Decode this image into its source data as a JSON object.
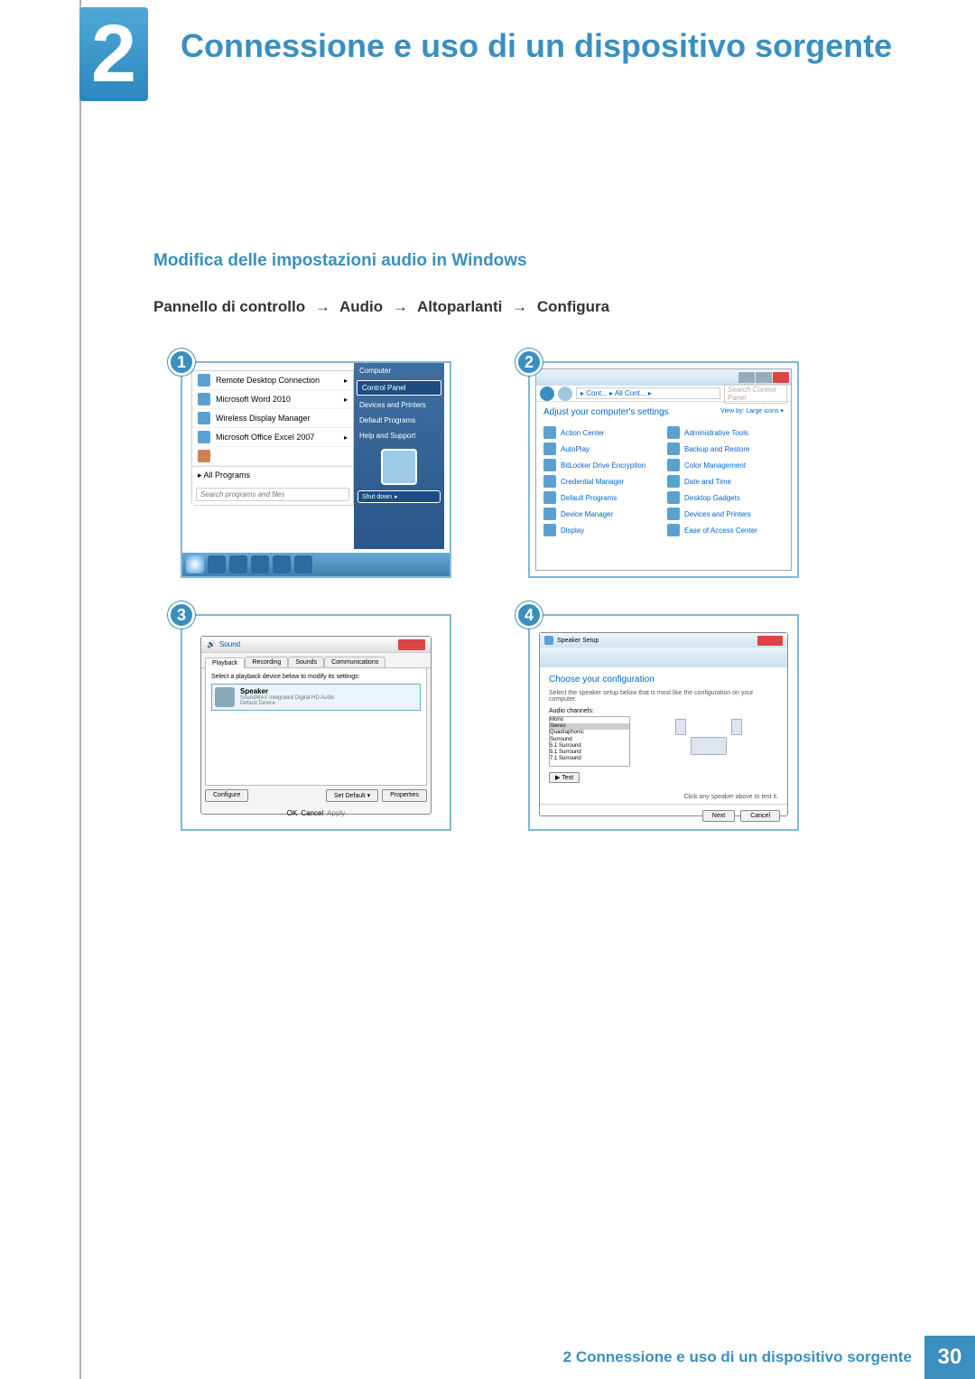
{
  "chapter": {
    "number": "2",
    "title": "Connessione e uso di un dispositivo sorgente"
  },
  "section": {
    "subtitle": "Modifica delle impostazioni audio in Windows"
  },
  "breadcrumb": {
    "p1": "Pannello di controllo",
    "p2": "Audio",
    "p3": "Altoparlanti",
    "p4": "Configura",
    "arrow": "→"
  },
  "steps": {
    "s1": {
      "num": "1",
      "items": [
        "Remote Desktop Connection",
        "Microsoft Word 2010",
        "Wireless Display Manager",
        "Microsoft Office Excel 2007"
      ],
      "all_programs": "All Programs",
      "search_placeholder": "Search programs and files",
      "right": {
        "computer": "Computer",
        "control_panel": "Control Panel",
        "devices_printers": "Devices and Printers",
        "default_programs": "Default Programs",
        "help_support": "Help and Support",
        "shutdown": "Shut down"
      }
    },
    "s2": {
      "num": "2",
      "path": "▸ Cont... ▸ All Cont... ▸",
      "search_placeholder": "Search Control Panel",
      "heading": "Adjust your computer's settings",
      "view_by": "View by: Large icons ▾",
      "links_left": [
        "Action Center",
        "AutoPlay",
        "BitLocker Drive Encryption",
        "Credential Manager",
        "Default Programs",
        "Device Manager",
        "Display"
      ],
      "links_right": [
        "Administrative Tools",
        "Backup and Restore",
        "Color Management",
        "Date and Time",
        "Desktop Gadgets",
        "Devices and Printers",
        "Ease of Access Center"
      ]
    },
    "s3": {
      "num": "3",
      "title": "Sound",
      "tabs": [
        "Playback",
        "Recording",
        "Sounds",
        "Communications"
      ],
      "instruction": "Select a playback device below to modify its settings:",
      "device": {
        "name": "Speaker",
        "sub1": "SoundMAX Integrated Digital HD Audio",
        "sub2": "Default Device"
      },
      "configure": "Configure",
      "set_default": "Set Default ▾",
      "properties": "Properties",
      "ok": "OK",
      "cancel": "Cancel",
      "apply": "Apply"
    },
    "s4": {
      "num": "4",
      "title": "Speaker Setup",
      "heading": "Choose your configuration",
      "desc": "Select the speaker setup below that is most like the configuration on your computer.",
      "channels_label": "Audio channels:",
      "channels": [
        "Mono",
        "Stereo",
        "Quadraphonic",
        "Surround",
        "5.1 Surround",
        "5.1 Surround",
        "7.1 Surround"
      ],
      "test": "▶ Test",
      "click_hint": "Click any speaker above to test it.",
      "next": "Next",
      "cancel": "Cancel"
    }
  },
  "footer": {
    "text": "2 Connessione e uso di un dispositivo sorgente",
    "page": "30"
  }
}
